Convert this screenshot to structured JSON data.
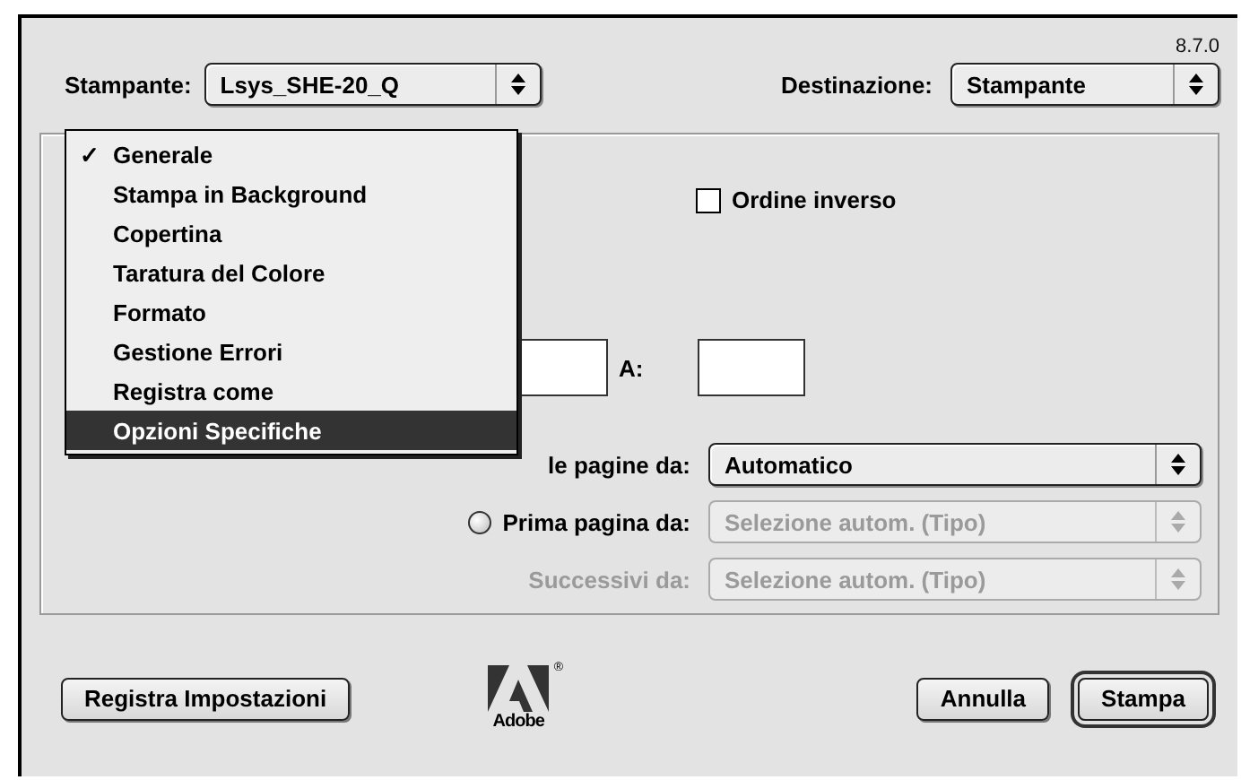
{
  "version": "8.7.0",
  "printer": {
    "label": "Stampante:",
    "value": "Lsys_SHE-20_Q"
  },
  "destination": {
    "label": "Destinazione:",
    "value": "Stampante"
  },
  "menu": {
    "check_mark": "✓",
    "items": [
      {
        "label": "Generale",
        "checked": true,
        "selected": false
      },
      {
        "label": "Stampa in Background",
        "checked": false,
        "selected": false
      },
      {
        "label": "Copertina",
        "checked": false,
        "selected": false
      },
      {
        "label": "Taratura del Colore",
        "checked": false,
        "selected": false
      },
      {
        "label": "Formato",
        "checked": false,
        "selected": false
      },
      {
        "label": "Gestione Errori",
        "checked": false,
        "selected": false
      },
      {
        "label": "Registra come",
        "checked": false,
        "selected": false
      },
      {
        "label": "Opzioni Specifiche",
        "checked": false,
        "selected": true
      }
    ]
  },
  "reverse_order": {
    "label": "Ordine inverso",
    "checked": false
  },
  "range": {
    "to_label": "A:"
  },
  "paper_source": {
    "options": [
      {
        "kind": "plain",
        "label": "le pagine da:",
        "popup": "Automatico",
        "disabled": false
      },
      {
        "kind": "radio",
        "label": "Prima pagina da:",
        "selected": false,
        "popup": "Selezione autom. (Tipo)",
        "disabled": true
      }
    ],
    "next": {
      "label": "Successivi da:",
      "popup": "Selezione autom. (Tipo)",
      "disabled": true
    }
  },
  "logo": {
    "text": "Adobe",
    "mark": "®"
  },
  "buttons": [
    {
      "label": "Registra Impostazioni",
      "default": false
    },
    {
      "label": "Annulla",
      "default": false
    },
    {
      "label": "Stampa",
      "default": true
    }
  ]
}
